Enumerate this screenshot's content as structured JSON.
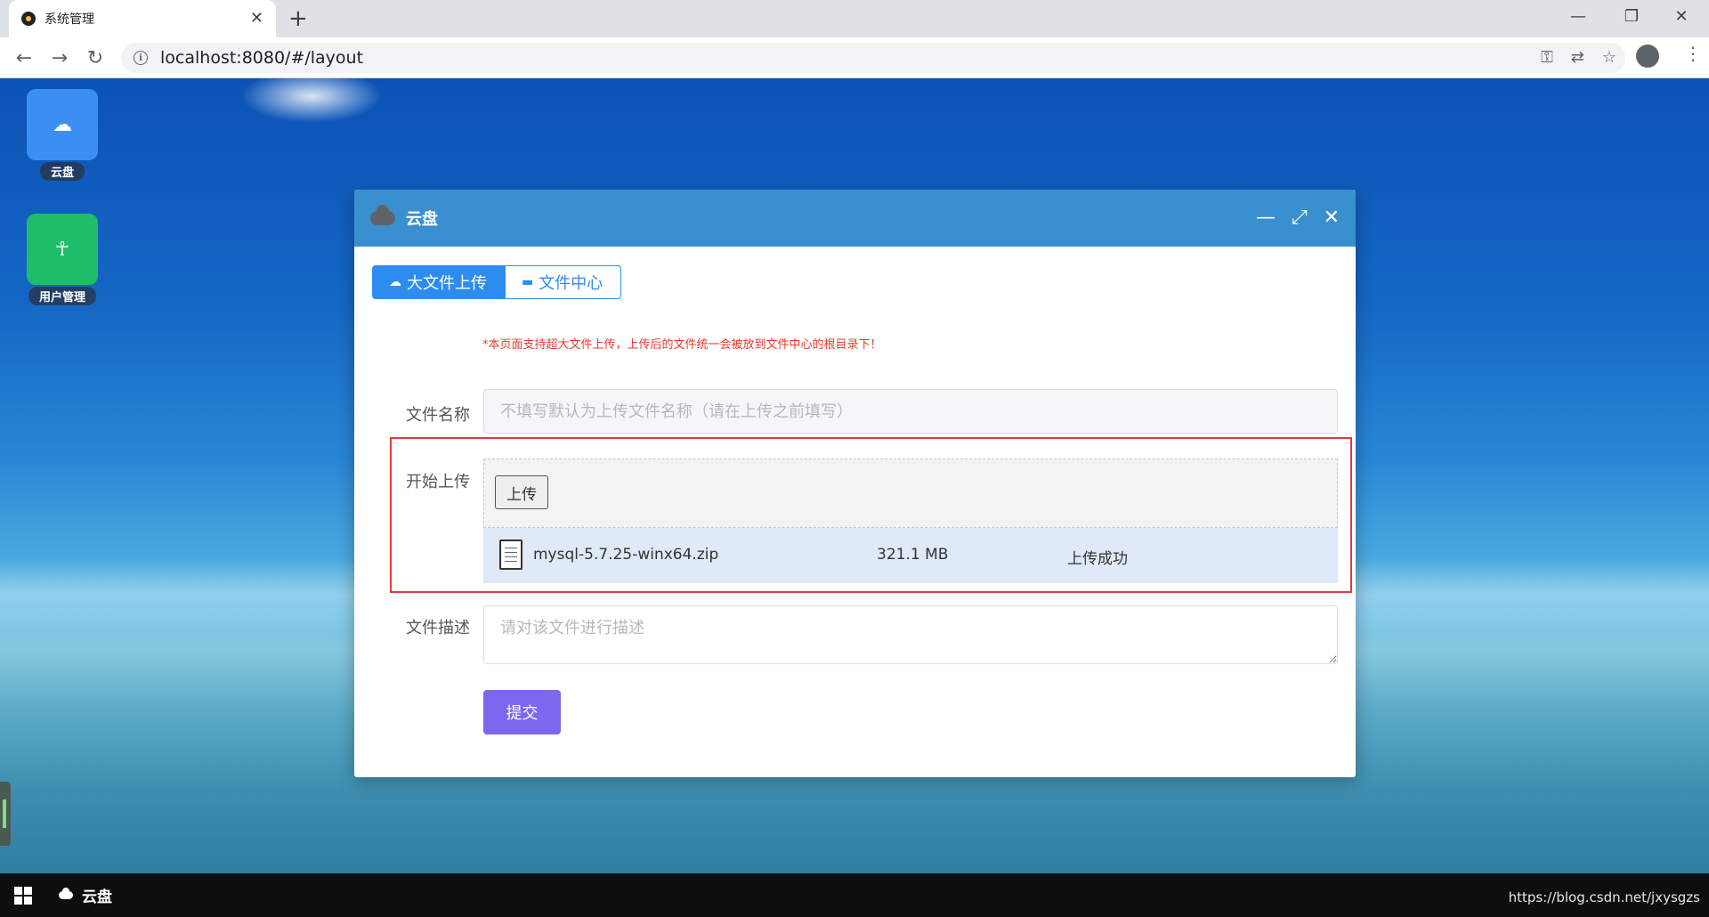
{
  "browser": {
    "tab_title": "系统管理",
    "tab_close": "✕",
    "new_tab": "+",
    "url": "localhost:8080/#/layout",
    "controls": {
      "minimize": "—",
      "restore": "❐",
      "close": "✕"
    },
    "nav": {
      "back": "←",
      "forward": "→",
      "reload": "↻"
    }
  },
  "desktop": {
    "icons": [
      {
        "label": "云盘",
        "glyph": "☁",
        "color": "#3b8ff3"
      },
      {
        "label": "用户管理",
        "glyph": "☥",
        "color": "#1fbd6a"
      }
    ]
  },
  "dialog": {
    "title": "云盘",
    "controls": {
      "minimize": "—",
      "maximize": "⤢",
      "close": "✕"
    },
    "tabs": [
      {
        "label": "大文件上传",
        "icon": "☁"
      },
      {
        "label": "文件中心",
        "icon": "▬"
      }
    ],
    "notice": "*本页面支持超大文件上传，上传后的文件统一会被放到文件中心的根目录下！",
    "form": {
      "filename_label": "文件名称",
      "filename_placeholder": "不填写默认为上传文件名称（请在上传之前填写）",
      "upload_label": "开始上传",
      "upload_button": "上传",
      "file": {
        "name": "mysql-5.7.25-winx64.zip",
        "size": "321.1 MB",
        "status": "上传成功"
      },
      "description_label": "文件描述",
      "description_placeholder": "请对该文件进行描述",
      "submit": "提交"
    }
  },
  "taskbar": {
    "app_label": "云盘",
    "watermark": "https://blog.csdn.net/jxysgzs"
  },
  "colors": {
    "dialog_header": "#3a8fcf",
    "tab_active": "#2d8cf0",
    "submit": "#7b68ee",
    "notice": "#e8382e",
    "highlight": "#e03a3a"
  }
}
